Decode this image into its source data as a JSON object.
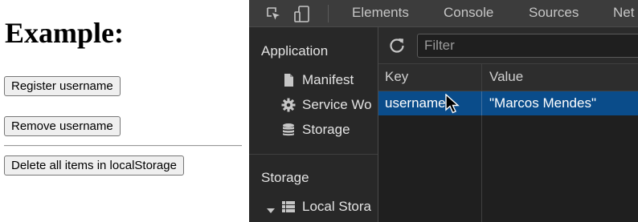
{
  "page": {
    "heading": "Example:",
    "buttons": {
      "register": "Register username",
      "remove": "Remove username",
      "delete_all": "Delete all items in localStorage"
    }
  },
  "devtools": {
    "icons": {
      "inspect": "inspect-element-icon",
      "device": "device-toolbar-icon"
    },
    "tabs": [
      "Elements",
      "Console",
      "Sources",
      "Net"
    ],
    "sidebar": {
      "application_heading": "Application",
      "application_items": [
        {
          "label": "Manifest",
          "icon": "document-icon"
        },
        {
          "label": "Service Wo",
          "icon": "gear-icon"
        },
        {
          "label": "Storage",
          "icon": "database-icon"
        }
      ],
      "storage_heading": "Storage",
      "storage_items": [
        {
          "label": "Local Stora",
          "icon": "grid-icon",
          "expanded": true
        }
      ]
    },
    "filter": {
      "placeholder": "Filter"
    },
    "table": {
      "columns": [
        "Key",
        "Value"
      ],
      "rows": [
        {
          "key": "username",
          "value": "\"Marcos Mendes\"",
          "selected": true
        }
      ]
    },
    "colors": {
      "selected_row": "#0a4c8a",
      "panel_bg": "#242424"
    }
  }
}
